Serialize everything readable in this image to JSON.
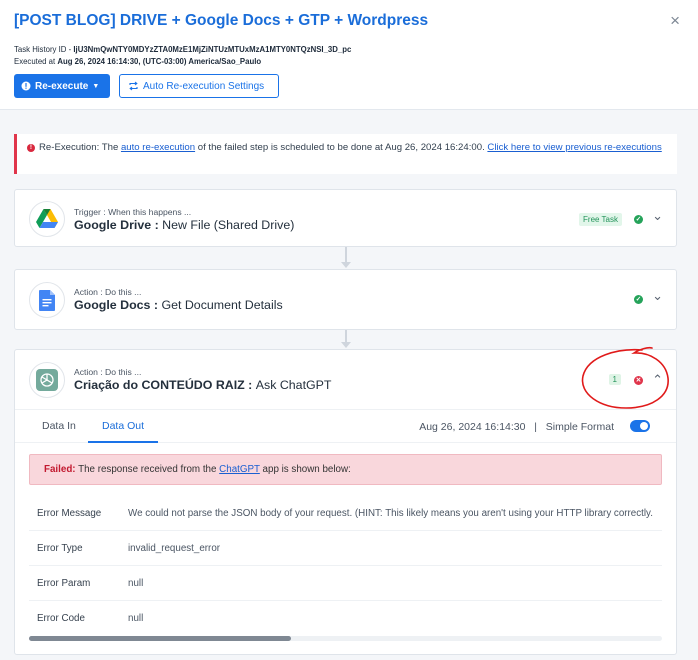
{
  "header": {
    "title": "[POST BLOG] DRIVE + Google Docs + GTP + Wordpress",
    "close": "×",
    "task_history_label": "Task History ID - ",
    "task_history_id": "IjU3NmQwNTY0MDYzZTA0MzE1MjZiNTUzMTUxMzA1MTY0NTQzNSI_3D_pc",
    "executed_label": "Executed at ",
    "executed_value": "Aug 26, 2024 16:14:30, (UTC-03:00) America/Sao_Paulo",
    "reexecute_label": "Re-execute",
    "auto_reexec_label": "Auto Re-execution Settings"
  },
  "notice": {
    "prefix": "Re-Execution: The ",
    "link1": "auto re-execution",
    "middle": " of the failed step is scheduled to be done at Aug 26, 2024 16:24:00. ",
    "link2": "Click here to view previous re-executions"
  },
  "steps": [
    {
      "label": "Trigger : When this happens ...",
      "app": "Google Drive",
      "sep": " : ",
      "event": "New File (Shared Drive)",
      "badge": "Free Task",
      "icon": "google-drive-icon"
    },
    {
      "label": "Action : Do this ...",
      "app": "Google Docs",
      "sep": " : ",
      "event": "Get Document Details",
      "icon": "google-docs-icon"
    },
    {
      "label": "Action : Do this ...",
      "app": "Criação do CONTEÚDO RAIZ",
      "sep": " : ",
      "event": "Ask ChatGPT",
      "count": "1",
      "icon": "chatgpt-icon"
    }
  ],
  "detail": {
    "tab_in": "Data In",
    "tab_out": "Data Out",
    "timestamp": "Aug 26, 2024 16:14:30",
    "divider": "|",
    "simple_format": "Simple Format",
    "failed_label": "Failed:",
    "failed_pre": " The response received from the ",
    "failed_link": "ChatGPT",
    "failed_post": " app is shown below:",
    "rows": [
      {
        "key": "Error Message",
        "value": "We could not parse the JSON body of your request. (HINT: This likely means you aren't using your HTTP library correctly."
      },
      {
        "key": "Error Type",
        "value": "invalid_request_error"
      },
      {
        "key": "Error Param",
        "value": "null"
      },
      {
        "key": "Error Code",
        "value": "null"
      }
    ]
  },
  "colors": {
    "accent": "#1a73e8",
    "error": "#e0354b",
    "success": "#25a35a"
  }
}
